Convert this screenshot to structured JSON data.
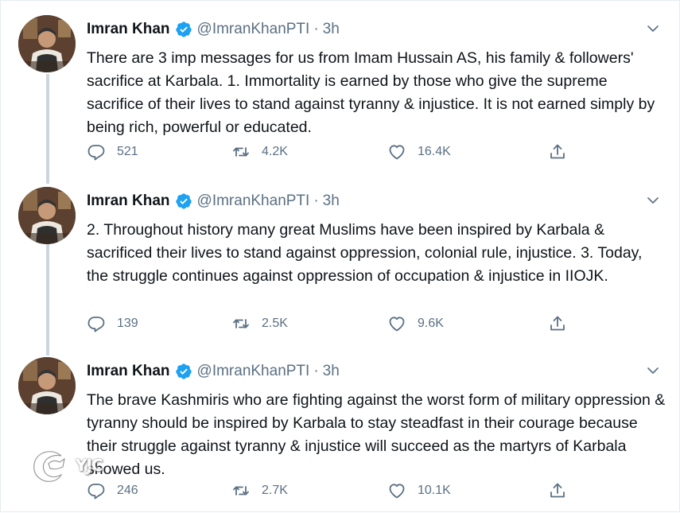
{
  "tweets": [
    {
      "name": "Imran Khan",
      "handle": "@ImranKhanPTI",
      "separator": "·",
      "time": "3h",
      "text": "There are 3 imp messages for us from Imam Hussain AS, his family & followers' sacrifice at Karbala. 1. Immortality is earned by those who give the supreme sacrifice of their lives to stand against tyranny & injustice. It is not earned simply by being rich, powerful or educated.",
      "replies": "521",
      "retweets": "4.2K",
      "likes": "16.4K"
    },
    {
      "name": "Imran Khan",
      "handle": "@ImranKhanPTI",
      "separator": "·",
      "time": "3h",
      "text": "2. Throughout history many great Muslims have been inspired by Karbala & sacrificed their lives to stand against oppression, colonial rule, injustice. 3. Today, the struggle continues against oppression of occupation & injustice in IIOJK.",
      "replies": "139",
      "retweets": "2.5K",
      "likes": "9.6K"
    },
    {
      "name": "Imran Khan",
      "handle": "@ImranKhanPTI",
      "separator": "·",
      "time": "3h",
      "text": "The brave Kashmiris who are fighting against the worst form of military oppression & tyranny should be inspired by Karbala to stay steadfast in their courage because their struggle against tyranny & injustice will succeed as the martyrs of Karbala showed us.",
      "replies": "246",
      "retweets": "2.7K",
      "likes": "10.1K"
    }
  ],
  "watermark": {
    "text": "YJC"
  },
  "icons": {
    "verified": "verified-badge-icon",
    "more": "chevron-down-icon",
    "reply": "reply-icon",
    "retweet": "retweet-icon",
    "like": "heart-icon",
    "share": "share-icon"
  },
  "colors": {
    "text": "#0f1419",
    "muted": "#5b7083",
    "verified": "#1da1f2",
    "thread_line": "#ccd6dd"
  }
}
